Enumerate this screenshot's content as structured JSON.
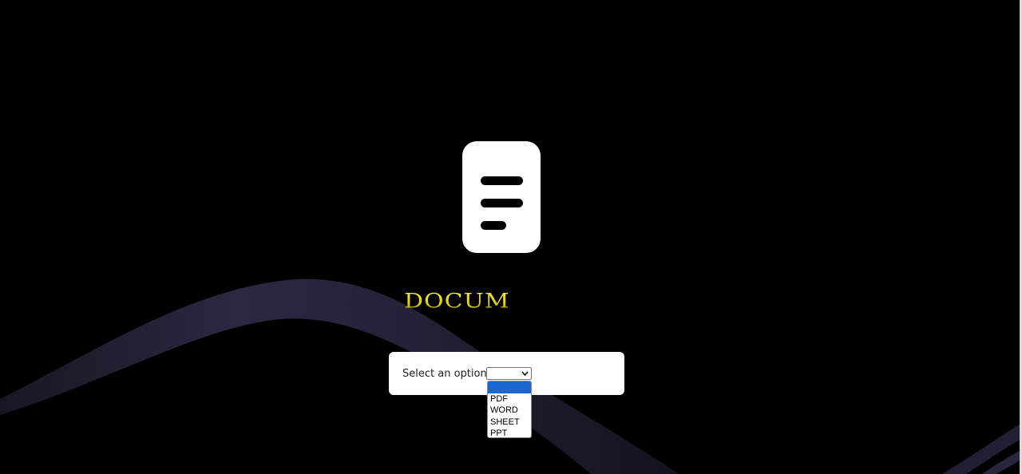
{
  "brand": {
    "visible_text": "DOCUM",
    "color": "#e6e600"
  },
  "logo": {
    "icon": "document-lines-icon",
    "background": "#ffffff",
    "lines_color": "#000000"
  },
  "background": {
    "color": "#000000",
    "ribbon_color": "#2e2a45"
  },
  "selector": {
    "label": "Select an option",
    "current_value": "",
    "options": [
      {
        "label": "",
        "selected": true
      },
      {
        "label": "PDF",
        "selected": false
      },
      {
        "label": "WORD",
        "selected": false
      },
      {
        "label": "SHEET",
        "selected": false
      },
      {
        "label": "PPT",
        "selected": false
      }
    ],
    "highlight_color": "#1a66d2"
  }
}
